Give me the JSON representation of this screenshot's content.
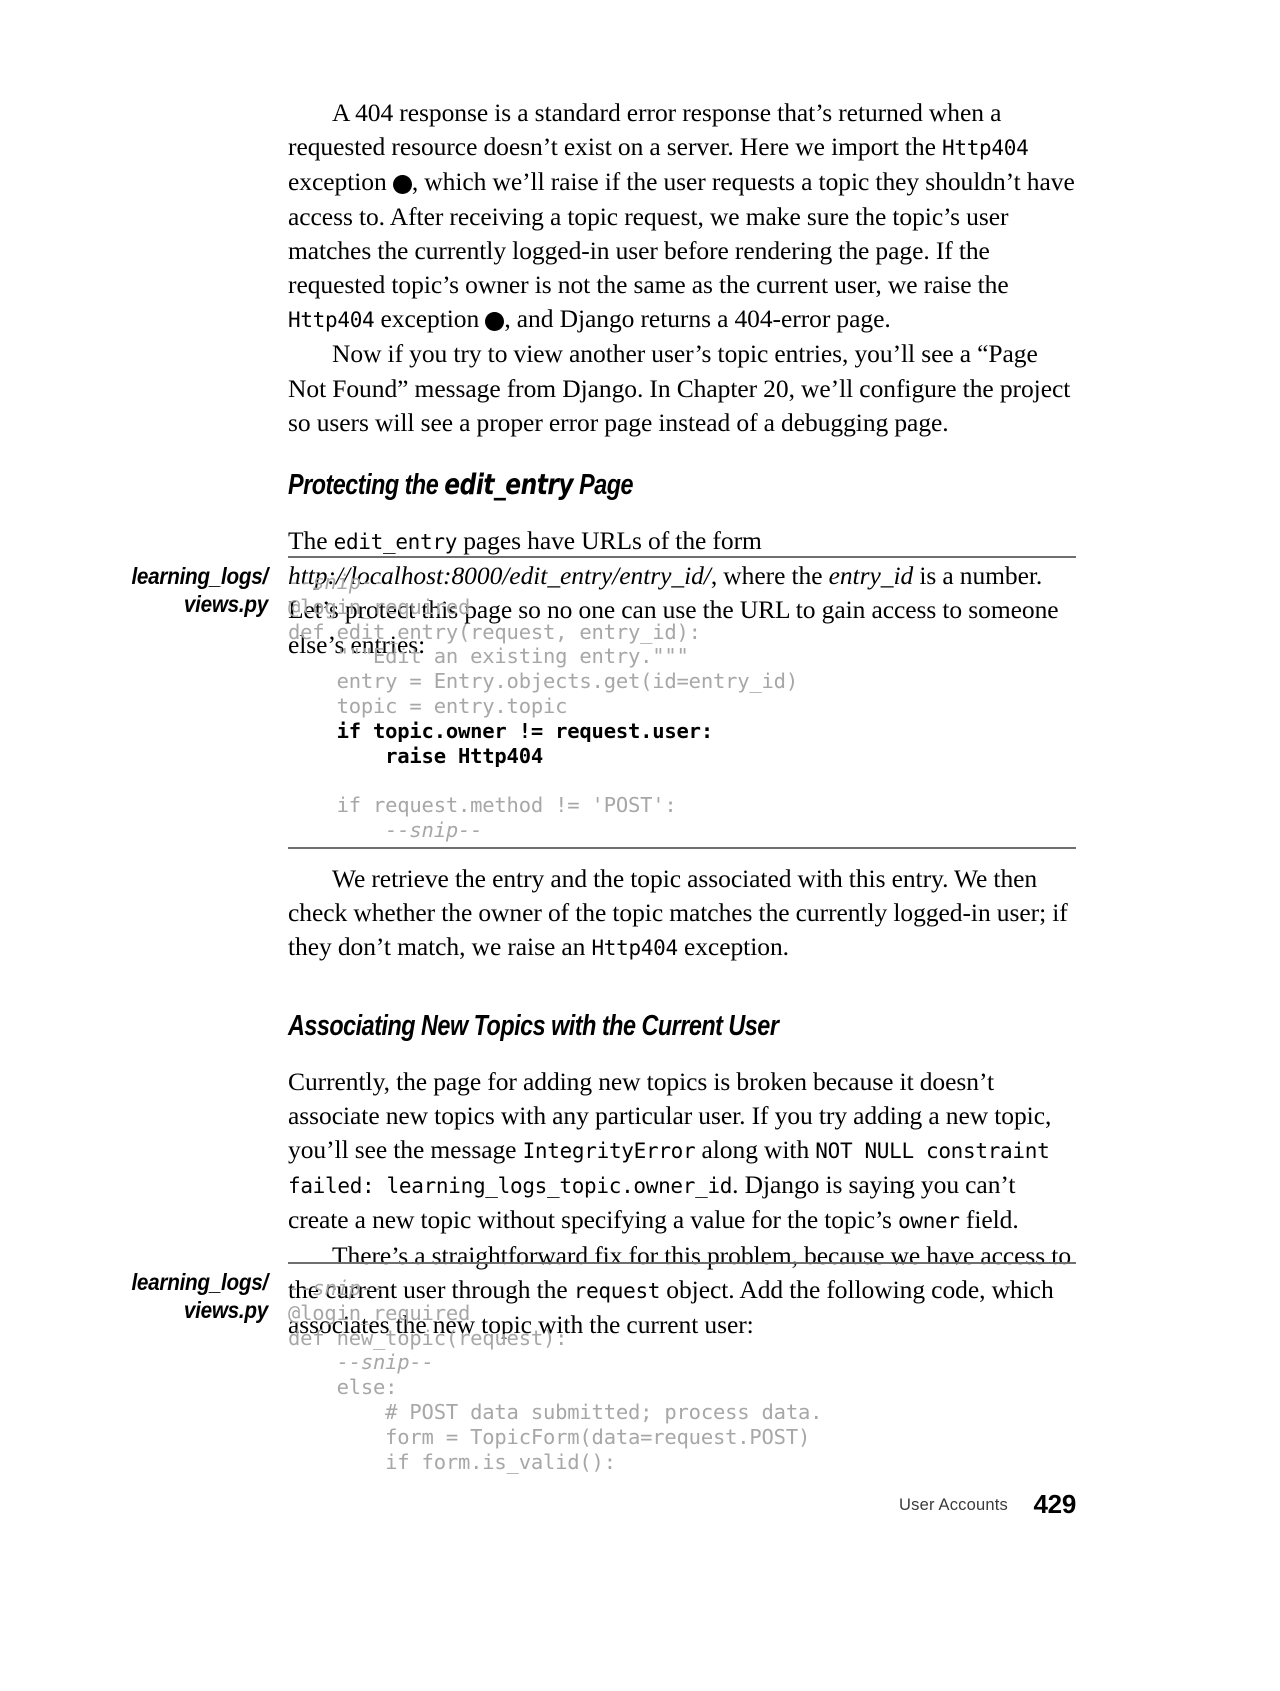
{
  "page": {
    "number": "429",
    "running_head": "User Accounts"
  },
  "paragraphs": {
    "p1_part1": "A 404 response is a standard error response that’s returned when a requested resource doesn’t exist on a server. Here we import the ",
    "p1_code1": "Http404",
    "p1_part2": " exception ",
    "p1_marker1": "❶",
    "p1_part3": ", which we’ll raise if the user requests a topic they shouldn’t have access to. After receiving a topic request, we make sure the topic’s user matches the currently logged-in user before rendering the page. If the requested topic’s owner is not the same as the current user, we raise the ",
    "p1_code2": "Http404",
    "p1_part4": " exception ",
    "p1_marker2": "❷",
    "p1_part5": ", and Django returns a 404-error page.",
    "p2": "Now if you try to view another user’s topic entries, you’ll see a “Page Not Found” message from Django. In Chapter 20, we’ll configure the project so users will see a proper error page instead of a debugging page.",
    "p3_part1": "The ",
    "p3_code1": "edit_entry",
    "p3_part2": " pages have URLs of the form ",
    "p3_italic1": "http://localhost:8000/edit_entry/entry_id/",
    "p3_part3": ", where the ",
    "p3_italic2": "entry_id",
    "p3_part4": " is a number. Let’s protect this page so no one can use the URL to gain access to someone else’s entries:",
    "p4_part1": "We retrieve the entry and the topic associated with this entry. We then check whether the owner of the topic matches the currently logged-in user; if they don’t match, we raise an ",
    "p4_code1": "Http404",
    "p4_part2": " exception.",
    "p5_part1": "Currently, the page for adding new topics is broken because it doesn’t associate new topics with any particular user. If you try adding a new topic, you’ll see the message ",
    "p5_code1": "IntegrityError",
    "p5_part2": " along with ",
    "p5_code2": "NOT NULL constraint failed: learning_logs_topic.owner_id",
    "p5_part3": ". Django is saying you can’t create a new topic without specifying a value for the topic’s ",
    "p5_code3": "owner",
    "p5_part4": " field.",
    "p6_part1": "There’s a straightforward fix for this problem, because we have access to the current user through the ",
    "p6_code1": "request",
    "p6_part2": " object. Add the following code, which associates the new topic with the current user:"
  },
  "headings": {
    "h1_part1": "Protecting the ",
    "h1_mono": "edit_entry",
    "h1_part2": " Page",
    "h2": "Associating New Topics with the Current User"
  },
  "listing1": {
    "file_line1": "learning_logs/",
    "file_line2": "views.py",
    "lines": [
      {
        "text": "--snip--",
        "style": "snip"
      },
      {
        "text": "@login_required",
        "style": "normal"
      },
      {
        "text": "def edit_entry(request, entry_id):",
        "style": "normal"
      },
      {
        "text": "    \"\"\"Edit an existing entry.\"\"\"",
        "style": "normal"
      },
      {
        "text": "    entry = Entry.objects.get(id=entry_id)",
        "style": "normal"
      },
      {
        "text": "    topic = entry.topic",
        "style": "normal"
      },
      {
        "text": "    if topic.owner != request.user:",
        "style": "hl"
      },
      {
        "text": "        raise Http404",
        "style": "hl"
      },
      {
        "text": "",
        "style": "normal"
      },
      {
        "text": "    if request.method != 'POST':",
        "style": "normal"
      },
      {
        "text": "        --snip--",
        "style": "snip"
      }
    ]
  },
  "listing2": {
    "file_line1": "learning_logs/",
    "file_line2": "views.py",
    "lines": [
      {
        "text": "--snip--",
        "style": "snip"
      },
      {
        "text": "@login_required",
        "style": "normal"
      },
      {
        "text": "def new_topic(request):",
        "style": "normal"
      },
      {
        "text": "    --snip--",
        "style": "snip"
      },
      {
        "text": "    else:",
        "style": "normal"
      },
      {
        "text": "        # POST data submitted; process data.",
        "style": "normal"
      },
      {
        "text": "        form = TopicForm(data=request.POST)",
        "style": "normal"
      },
      {
        "text": "        if form.is_valid():",
        "style": "normal"
      }
    ]
  }
}
